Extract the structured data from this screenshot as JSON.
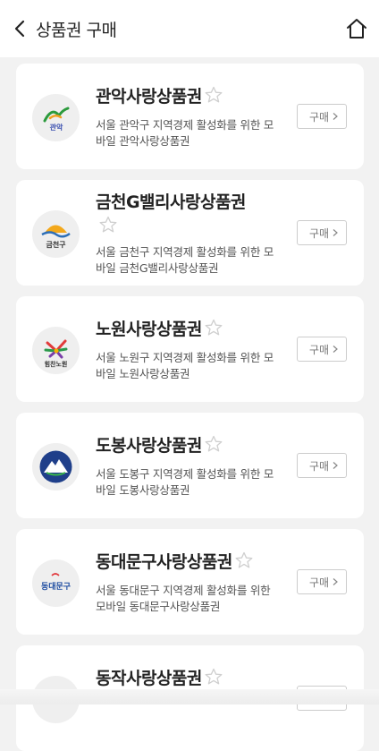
{
  "header": {
    "title": "상품권 구매",
    "back_icon": "chevron-left-icon",
    "home_icon": "home-icon"
  },
  "vouchers": [
    {
      "name": "관악사랑상품권",
      "logo_text": "관악",
      "description": "서울 관악구 지역경제 활성화를 위한 모바일 관악사랑상품권",
      "buy_label": "구매"
    },
    {
      "name": "금천G밸리사랑상품권",
      "logo_text": "금천구",
      "description": "서울 금천구 지역경제 활성화를 위한 모바일 금천G밸리사랑상품권",
      "buy_label": "구매"
    },
    {
      "name": "노원사랑상품권",
      "logo_text": "힘찬노원",
      "description": "서울 노원구 지역경제 활성화를 위한 모바일 노원사랑상품권",
      "buy_label": "구매"
    },
    {
      "name": "도봉사랑상품권",
      "logo_text": "",
      "description": "서울 도봉구 지역경제 활성화를 위한 모바일 도봉사랑상품권",
      "buy_label": "구매"
    },
    {
      "name": "동대문구사랑상품권",
      "logo_text": "동대문구",
      "description": "서울 동대문구 지역경제 활성화를 위한 모바일 동대문구사랑상품권",
      "buy_label": "구매"
    },
    {
      "name": "동작사랑상품권",
      "logo_text": "",
      "description": "",
      "buy_label": "구매"
    }
  ],
  "colors": {
    "background": "#f2f2f2",
    "card": "#ffffff",
    "star_outline": "#cfcfcf"
  }
}
